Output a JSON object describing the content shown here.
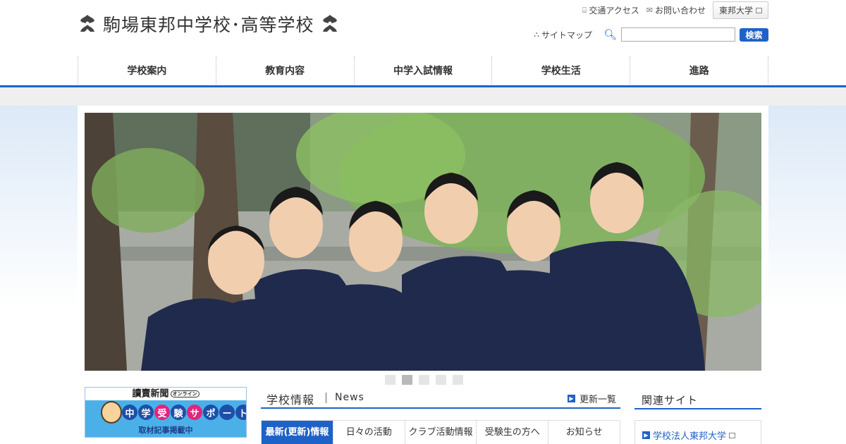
{
  "header": {
    "logo_text": "駒場東邦中学校･高等学校",
    "util_links": {
      "access": "交通アクセス",
      "contact": "お問い合わせ",
      "university": "東邦大学"
    },
    "sitemap": "サイトマップ",
    "search": {
      "value": "",
      "placeholder": "",
      "button": "検索"
    }
  },
  "gnav": [
    "学校案内",
    "教育内容",
    "中学入試情報",
    "学校生活",
    "進路"
  ],
  "hero": {
    "slides": 5,
    "active_slide": 2
  },
  "banner": {
    "top": "讀賣新聞",
    "online": "オンライン",
    "main_chars": [
      "中",
      "学",
      "受",
      "験",
      "サ",
      "ポ",
      "ー",
      "ト"
    ],
    "sub": "取材記事掲載中"
  },
  "news": {
    "title": "学校情報",
    "title_en": "News",
    "more": "更新一覧",
    "tabs": [
      "最新(更新)情報",
      "日々の活動",
      "クラブ活動情報",
      "受験生の方へ",
      "お知らせ"
    ],
    "active_tab": 0
  },
  "related": {
    "title": "関連サイト",
    "links": [
      "学校法人東邦大学"
    ]
  },
  "colors": {
    "accent": "#1e62c8",
    "nav_band": "#efefef"
  }
}
